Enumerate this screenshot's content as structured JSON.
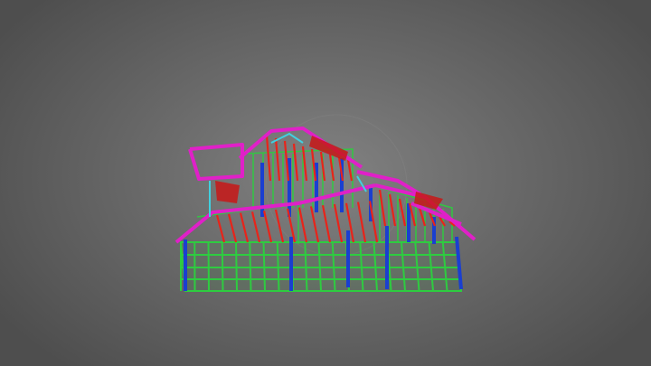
{
  "viewer": {
    "background": {
      "center": "#828282",
      "edge": "#4e4e4e"
    },
    "model_colors": {
      "walls_green": "#2ecc40",
      "posts_blue": "#1a3fd0",
      "roof_magenta": "#e020c8",
      "rafters_red": "#e8241a",
      "accent_cyan": "#40d0e0"
    }
  }
}
